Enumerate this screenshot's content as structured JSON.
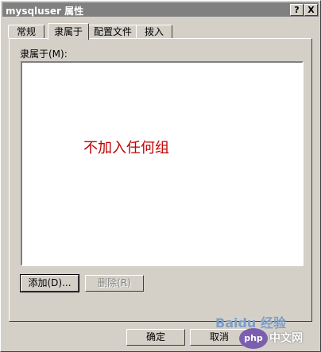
{
  "window": {
    "title": "mysqluser 属性",
    "help_btn": "?",
    "close_btn": "X"
  },
  "tabs": [
    {
      "label": "常规"
    },
    {
      "label": "隶属于"
    },
    {
      "label": "配置文件"
    },
    {
      "label": "拨入"
    }
  ],
  "member_of": {
    "label": "隶属于(M):",
    "annotation": "不加入任何组"
  },
  "buttons": {
    "add": "添加(D)...",
    "remove": "删除(R)",
    "ok": "确定",
    "cancel": "取消"
  },
  "watermark": {
    "baidu": "Baidu 经验",
    "php": "php",
    "site": "中文网"
  },
  "colors": {
    "annotation": "#c00000",
    "titlebar": "#808080"
  }
}
